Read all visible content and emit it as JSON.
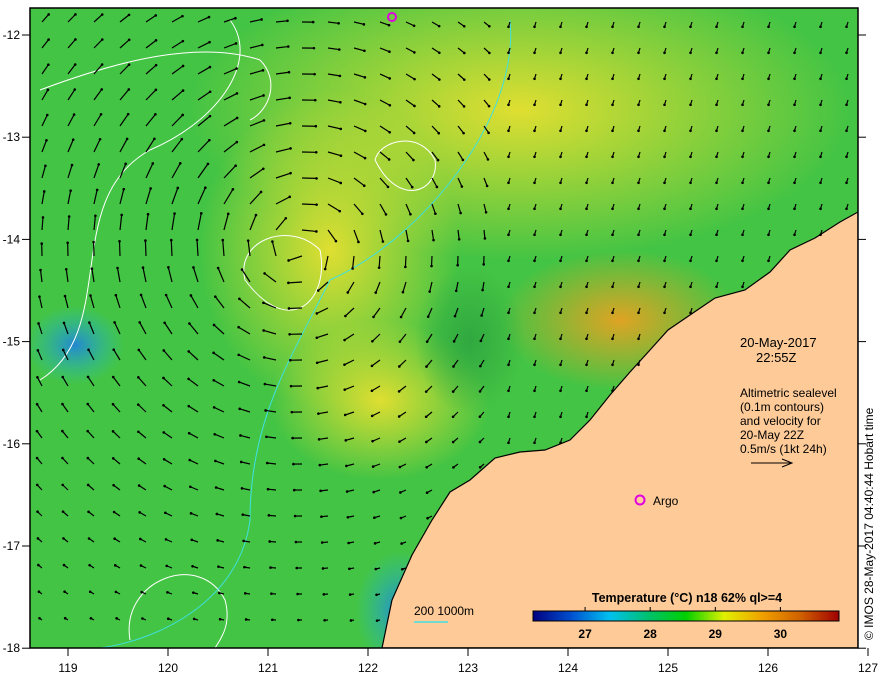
{
  "map": {
    "x_ticks": [
      "119",
      "120",
      "121",
      "122",
      "123",
      "124",
      "125",
      "126",
      "127"
    ],
    "y_ticks": [
      "-12",
      "-13",
      "-14",
      "-15",
      "-16",
      "-17",
      "-18"
    ],
    "lon_range": [
      118.62,
      127
    ],
    "lat_range": [
      -11.73,
      -18
    ]
  },
  "annotation": {
    "date": "20-May-2017",
    "time": "22:55Z",
    "lines": [
      "Altimetric sealevel",
      "(0.1m contours)",
      "and velocity for",
      "20-May 22Z",
      "0.5m/s (1kt 24h)"
    ]
  },
  "argo": {
    "label": "Argo",
    "color": "#e000e0"
  },
  "scale": {
    "label": "200  1000m"
  },
  "colorbar": {
    "title": "Temperature (°C) n18 62% ql>=4",
    "ticks": [
      "27",
      "28",
      "29",
      "30"
    ],
    "range": [
      26.2,
      30.9
    ],
    "colors": [
      "#000080",
      "#0050d0",
      "#00c0f0",
      "#00c070",
      "#00d000",
      "#e0f000",
      "#f0a000",
      "#d06000",
      "#a00000"
    ]
  },
  "credit": "© IMOS 28-May-2017 04:40:44 Hobart time",
  "colors": {
    "land": "#fdca98",
    "ocean": "#40c040",
    "contour": "#ffffff",
    "isobath": "#40e0e0"
  }
}
